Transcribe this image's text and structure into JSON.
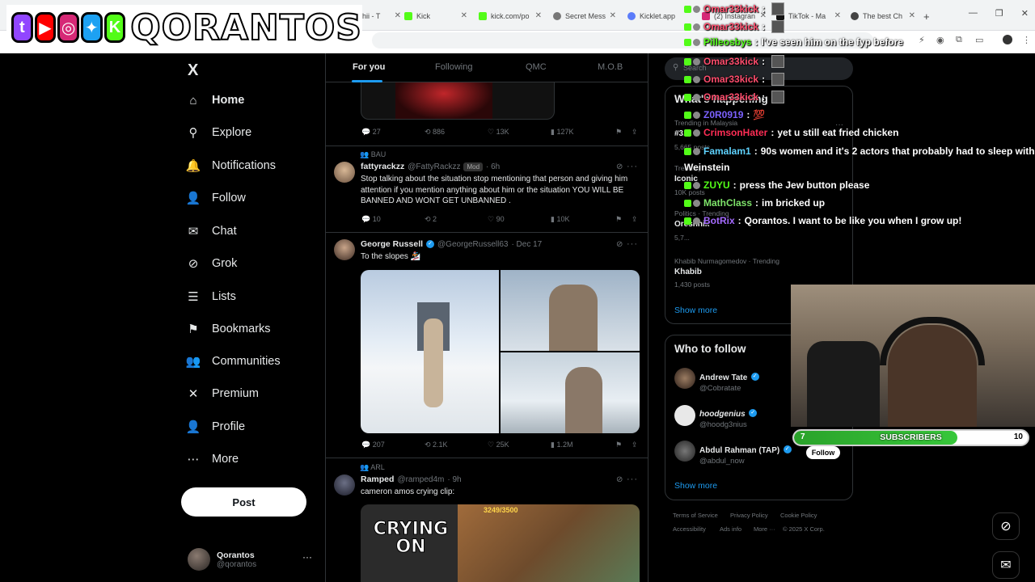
{
  "browser": {
    "tabs": [
      {
        "label": "hii - T"
      },
      {
        "label": "Kick"
      },
      {
        "label": "kick.com/po"
      },
      {
        "label": "Secret Mess"
      },
      {
        "label": "Kicklet.app"
      },
      {
        "label": "(2) Instagran"
      },
      {
        "label": "TikTok - Ma"
      },
      {
        "label": "The best Ch"
      }
    ],
    "new_tab": "+",
    "window_controls": [
      "—",
      "❐",
      "✕"
    ]
  },
  "overlay": {
    "brand": "QORANTOS",
    "socials": [
      {
        "icon": "twitch-icon",
        "glyph": "t",
        "color": "#9146ff"
      },
      {
        "icon": "youtube-icon",
        "glyph": "▶",
        "color": "#ff0000"
      },
      {
        "icon": "instagram-icon",
        "glyph": "◎",
        "color": "#d62976"
      },
      {
        "icon": "twitter-bird-icon",
        "glyph": "✦",
        "color": "#1da1f2"
      },
      {
        "icon": "kick-icon",
        "glyph": "K",
        "color": "#53fc18"
      }
    ]
  },
  "nav": {
    "logo": "X",
    "items": [
      {
        "label": "Home",
        "icon": "home-icon",
        "glyph": "⌂",
        "active": true
      },
      {
        "label": "Explore",
        "icon": "search-icon",
        "glyph": "⚲"
      },
      {
        "label": "Notifications",
        "icon": "bell-icon",
        "glyph": "🔔"
      },
      {
        "label": "Follow",
        "icon": "follow-icon",
        "glyph": "👤"
      },
      {
        "label": "Chat",
        "icon": "mail-icon",
        "glyph": "✉"
      },
      {
        "label": "Grok",
        "icon": "grok-icon",
        "glyph": "⊘"
      },
      {
        "label": "Lists",
        "icon": "list-icon",
        "glyph": "☰"
      },
      {
        "label": "Bookmarks",
        "icon": "bookmark-icon",
        "glyph": "⚑"
      },
      {
        "label": "Communities",
        "icon": "communities-icon",
        "glyph": "👥"
      },
      {
        "label": "Premium",
        "icon": "x-premium-icon",
        "glyph": "✕"
      },
      {
        "label": "Profile",
        "icon": "profile-icon",
        "glyph": "👤"
      },
      {
        "label": "More",
        "icon": "more-circle-icon",
        "glyph": "⋯"
      }
    ],
    "post_label": "Post",
    "me": {
      "name": "Qorantos",
      "handle": "@qorantos",
      "more": "···"
    }
  },
  "timeline": {
    "tabs": [
      "For you",
      "Following",
      "QMC",
      "M.O.B"
    ],
    "tweet0": {
      "replies": "27",
      "reposts": "886",
      "likes": "13K",
      "views": "127K"
    },
    "tweet1": {
      "context": "BAU",
      "name": "fattyrackzz",
      "handle": "@FattyRackzz",
      "mod": "Mod",
      "time": "· 6h",
      "text": "Stop talking about the situation stop mentioning that person and giving him attention if you mention anything about him or the situation YOU WILL BE BANNED AND WONT GET UNBANNED .",
      "replies": "10",
      "reposts": "2",
      "likes": "90",
      "views": "10K"
    },
    "tweet2": {
      "name": "George Russell",
      "handle": "@GeorgeRussell63",
      "time": "· Dec 17",
      "text": "To the slopes 🏂",
      "replies": "207",
      "reposts": "2.1K",
      "likes": "25K",
      "views": "1.2M"
    },
    "tweet3": {
      "context": "ARL",
      "name": "Ramped",
      "handle": "@ramped4m",
      "time": "· 9h",
      "text": "cameron amos crying clip:",
      "media_text": "CRYING ON",
      "media_counter": "3249/3500"
    }
  },
  "right": {
    "search_placeholder": "Search",
    "happening_title": "What's happening",
    "trends": [
      {
        "meta": "Trending in Malaysia",
        "name": "#3...",
        "posts": "5,665 posts"
      },
      {
        "meta": "Trending",
        "name": "Iconic",
        "posts": "10K posts"
      },
      {
        "meta": "Politics · Trending",
        "name": "Oreshnik",
        "posts": "5,7..."
      },
      {
        "meta": "Khabib Nurmagomedov · Trending",
        "name": "Khabib",
        "posts": "1,430 posts"
      }
    ],
    "show_more": "Show more",
    "who_title": "Who to follow",
    "who": [
      {
        "name": "Andrew Tate",
        "handle": "@Cobratate"
      },
      {
        "name": "hoodgenius",
        "handle": "@hoodg3nius"
      },
      {
        "name": "Abdul Rahman (TAP)",
        "handle": "@abdul_now",
        "follow": "Follow"
      }
    ],
    "show_more2": "Show more",
    "footer": [
      "Terms of Service",
      "Privacy Policy",
      "Cookie Policy",
      "Accessibility",
      "Ads info",
      "More ···",
      "© 2025 X Corp."
    ]
  },
  "chat": [
    {
      "user": "Pilleosbys",
      "color": "#53fc18",
      "msg": "I've seen him on the fyp before"
    },
    {
      "user": "Omar33kick",
      "color": "#ff4d6d",
      "msg": ""
    },
    {
      "user": "Omar33kick",
      "color": "#ff4d6d",
      "msg": ""
    },
    {
      "user": "Omar33kick",
      "color": "#ff4d6d",
      "msg": ""
    },
    {
      "user": "Omar33kick",
      "color": "#ff4d6d",
      "msg": ""
    },
    {
      "user": "Omar33kick",
      "color": "#ff4d6d",
      "msg": ""
    },
    {
      "user": "Z0R0919",
      "color": "#7b61ff",
      "msg": "💯"
    },
    {
      "user": "CrimsonHater",
      "color": "#ff2d55",
      "msg": "yet u still eat fried chicken"
    },
    {
      "user": "Famalam1",
      "color": "#5fd3ff",
      "msg": "90s women and it's 2 actors that probably had to sleep with"
    },
    {
      "user": "",
      "color": "#fff",
      "msg": "Weinstein"
    },
    {
      "user": "ZUYU",
      "color": "#53fc18",
      "msg": "press the Jew button please"
    },
    {
      "user": "MathClass",
      "color": "#7ee36a",
      "msg": "im bricked up"
    },
    {
      "user": "BotRix",
      "color": "#a56bff",
      "msg": "Qorantos. I want to be like you when I grow up!"
    }
  ],
  "subs": {
    "label": "SUBSCRIBERS",
    "current": "7",
    "goal": "10",
    "progress": 0.7
  }
}
